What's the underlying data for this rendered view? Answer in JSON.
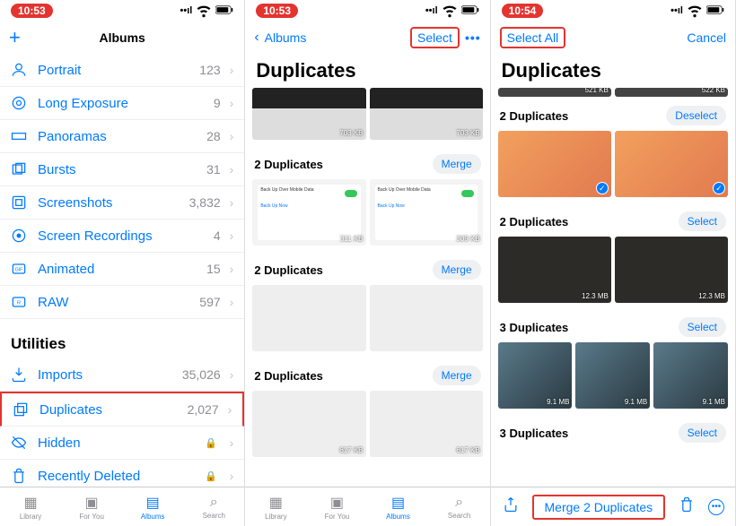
{
  "statusBar": {
    "time1": "10:53",
    "time2": "10:53",
    "time3": "10:54"
  },
  "screen1": {
    "nav": {
      "title": "Albums",
      "add": "+"
    },
    "rows": [
      {
        "icon": "portrait",
        "label": "Portrait",
        "count": "123"
      },
      {
        "icon": "longexposure",
        "label": "Long Exposure",
        "count": "9"
      },
      {
        "icon": "panorama",
        "label": "Panoramas",
        "count": "28"
      },
      {
        "icon": "bursts",
        "label": "Bursts",
        "count": "31"
      },
      {
        "icon": "screenshots",
        "label": "Screenshots",
        "count": "3,832"
      },
      {
        "icon": "screenrec",
        "label": "Screen Recordings",
        "count": "4"
      },
      {
        "icon": "animated",
        "label": "Animated",
        "count": "15"
      },
      {
        "icon": "raw",
        "label": "RAW",
        "count": "597"
      }
    ],
    "utilitiesTitle": "Utilities",
    "utilities": [
      {
        "icon": "imports",
        "label": "Imports",
        "count": "35,026"
      },
      {
        "icon": "duplicates",
        "label": "Duplicates",
        "count": "2,027",
        "highlighted": true
      },
      {
        "icon": "hidden",
        "label": "Hidden",
        "locked": true
      },
      {
        "icon": "deleted",
        "label": "Recently Deleted",
        "locked": true
      }
    ]
  },
  "screen2": {
    "nav": {
      "back": "Albums",
      "select": "Select"
    },
    "title": "Duplicates",
    "topBadges": {
      "a": "703 KB",
      "b": "703 KB"
    },
    "groups": [
      {
        "title": "2 Duplicates",
        "action": "Merge",
        "badges": [
          "311 KB",
          "309 KB"
        ],
        "style": "sett"
      },
      {
        "title": "2 Duplicates",
        "action": "Merge",
        "badges": [
          "",
          ""
        ],
        "style": "scr"
      },
      {
        "title": "2 Duplicates",
        "action": "Merge",
        "badges": [
          "617 KB",
          "617 KB"
        ],
        "style": "scr"
      }
    ]
  },
  "screen3": {
    "nav": {
      "selectAll": "Select All",
      "cancel": "Cancel"
    },
    "title": "Duplicates",
    "topBadges": {
      "a": "521 KB",
      "b": "522 KB"
    },
    "groups": [
      {
        "title": "2 Duplicates",
        "action": "Deselect",
        "badges": [
          "",
          ""
        ],
        "style": "face",
        "checked": true
      },
      {
        "title": "2 Duplicates",
        "action": "Select",
        "badges": [
          "12.3 MB",
          "12.3 MB"
        ],
        "style": "dark"
      },
      {
        "title": "3 Duplicates",
        "action": "Select",
        "badges": [
          "9.1 MB",
          "9.1 MB",
          "9.1 MB"
        ],
        "style": "home"
      },
      {
        "title": "3 Duplicates",
        "action": "Select",
        "badges": [],
        "style": "scr"
      }
    ],
    "mergeAction": "Merge 2 Duplicates"
  },
  "tabs": [
    {
      "label": "Library"
    },
    {
      "label": "For You"
    },
    {
      "label": "Albums",
      "active": true
    },
    {
      "label": "Search"
    }
  ]
}
